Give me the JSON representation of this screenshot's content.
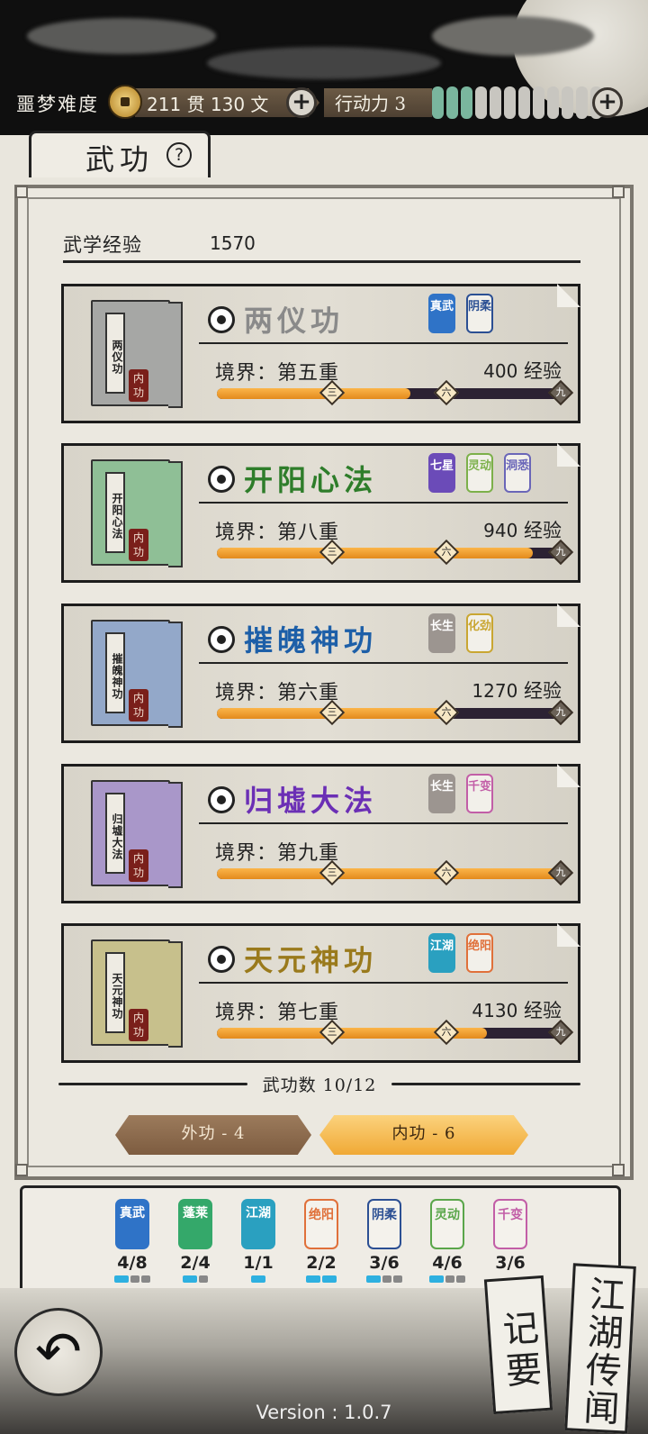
{
  "header": {
    "difficulty": "噩梦难度",
    "money": "211 贯  130  文",
    "action_points_label": "行动力 3",
    "action_points": 3,
    "action_points_max": 12
  },
  "tab": {
    "label": "武功",
    "help": "?"
  },
  "exp": {
    "label": "武学经验",
    "value": "1570"
  },
  "skills": [
    {
      "name": "两仪功",
      "color": "#8a8a8a",
      "book_title": "两仪功",
      "book_color": "#a6a7a5",
      "seal": "内功",
      "realm": "境界：第五重",
      "exp_num": "400",
      "exp_unit": "经验",
      "progress": 0.55,
      "tags": [
        {
          "text": "真武",
          "color": "#2f73c7",
          "style": "solid"
        },
        {
          "text": "阴柔",
          "color": "#2b4f93",
          "style": "outline"
        }
      ]
    },
    {
      "name": "开阳心法",
      "color": "#2e7d2a",
      "book_title": "开阳心法",
      "book_color": "#8fbf96",
      "seal": "内功",
      "realm": "境界：第八重",
      "exp_num": "940",
      "exp_unit": "经验",
      "progress": 0.9,
      "tags": [
        {
          "text": "七星",
          "color": "#6b4bb8",
          "style": "solid"
        },
        {
          "text": "灵动",
          "color": "#7cb04a",
          "style": "outline"
        },
        {
          "text": "洞悉",
          "color": "#6a66b8",
          "style": "outline"
        }
      ]
    },
    {
      "name": "摧魄神功",
      "color": "#1d5fa8",
      "book_title": "摧魄神功",
      "book_color": "#93a8c9",
      "seal": "内功",
      "realm": "境界：第六重",
      "exp_num": "1270",
      "exp_unit": "经验",
      "progress": 0.66,
      "tags": [
        {
          "text": "长生",
          "color": "#9c9590",
          "style": "solid"
        },
        {
          "text": "化劲",
          "color": "#c9a632",
          "style": "outline"
        }
      ]
    },
    {
      "name": "归墟大法",
      "color": "#6b2fb5",
      "book_title": "归墟大法",
      "book_color": "#a997c9",
      "seal": "内功",
      "realm": "境界：第九重",
      "exp_num": "",
      "exp_unit": "",
      "progress": 1.0,
      "tags": [
        {
          "text": "长生",
          "color": "#9c9590",
          "style": "solid"
        },
        {
          "text": "千变",
          "color": "#c25ea7",
          "style": "outline"
        }
      ]
    },
    {
      "name": "天元神功",
      "color": "#9a7a1c",
      "book_title": "天元神功",
      "book_color": "#c7c08c",
      "seal": "内功",
      "realm": "境界：第七重",
      "exp_num": "4130",
      "exp_unit": "经验",
      "progress": 0.77,
      "tags": [
        {
          "text": "江湖",
          "color": "#2aa0c0",
          "style": "solid"
        },
        {
          "text": "绝阳",
          "color": "#e0703a",
          "style": "outline"
        }
      ]
    }
  ],
  "progress_marks": [
    "三",
    "六",
    "九"
  ],
  "skill_count": "武功数 10/12",
  "categories": {
    "outer": "外功 - 4",
    "inner": "内功 - 6"
  },
  "sets": [
    {
      "name": "真武",
      "count": "4/8",
      "color": "#2f73c7",
      "style": "solid",
      "dots": 3,
      "on": 1
    },
    {
      "name": "蓬莱",
      "count": "2/4",
      "color": "#34a86a",
      "style": "solid",
      "dots": 2,
      "on": 1
    },
    {
      "name": "江湖",
      "count": "1/1",
      "color": "#2aa0c0",
      "style": "solid",
      "dots": 1,
      "on": 1
    },
    {
      "name": "绝阳",
      "count": "2/2",
      "color": "#e0703a",
      "style": "outline",
      "dots": 2,
      "on": 2
    },
    {
      "name": "阴柔",
      "count": "3/6",
      "color": "#2b4f93",
      "style": "outline",
      "dots": 3,
      "on": 1
    },
    {
      "name": "灵动",
      "count": "4/6",
      "color": "#5aa64a",
      "style": "outline",
      "dots": 3,
      "on": 1
    },
    {
      "name": "千变",
      "count": "3/6",
      "color": "#c25ea7",
      "style": "outline",
      "dots": 0,
      "on": 0
    }
  ],
  "bottom": {
    "back_icon": "undo-arrow-icon",
    "notes_label": "记要",
    "legend_label": "江湖传闻",
    "version": "Version : 1.0.7"
  }
}
